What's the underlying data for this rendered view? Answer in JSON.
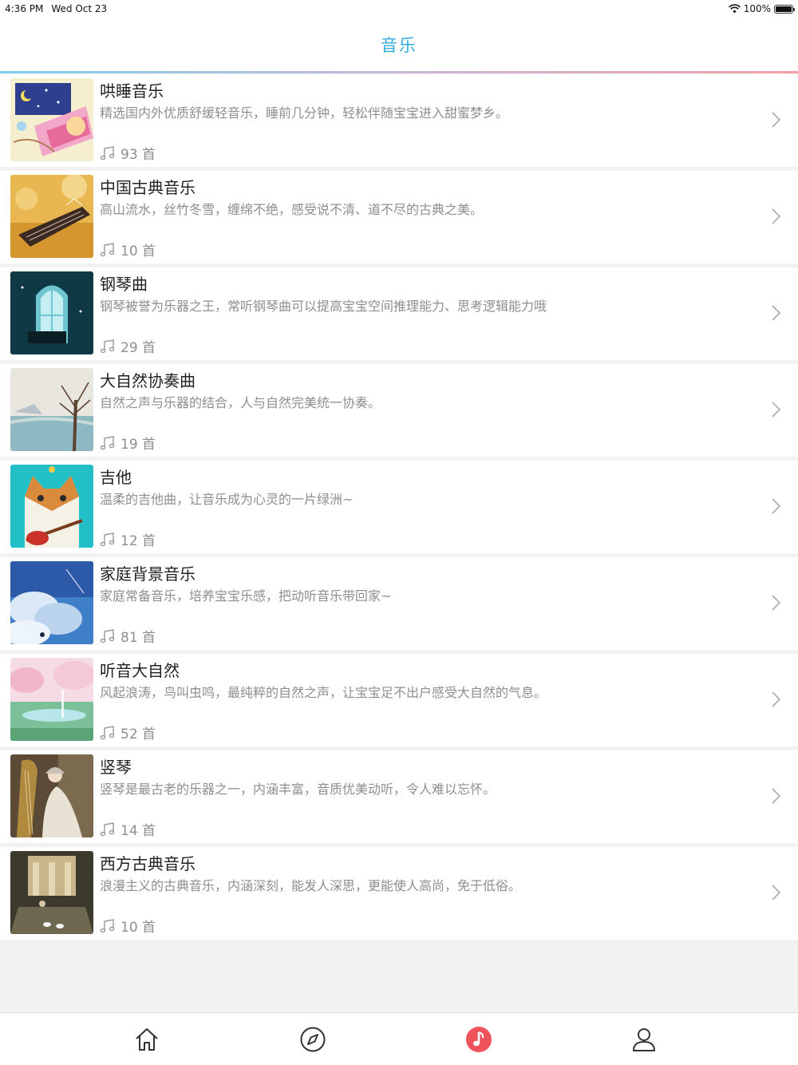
{
  "status": {
    "time": "4:36 PM",
    "date": "Wed Oct 23",
    "battery_text": "100%",
    "battery_level": 1.0
  },
  "header": {
    "title": "音乐"
  },
  "categories": [
    {
      "title": "哄睡音乐",
      "desc": "精选国内外优质舒缓轻音乐，睡前几分钟，轻松伴随宝宝进入甜蜜梦乡。",
      "count": "93 首",
      "thumb_icon": "lullaby-thumbnail"
    },
    {
      "title": "中国古典音乐",
      "desc": "高山流水，丝竹冬雪，缠绵不绝，感受说不清、道不尽的古典之美。",
      "count": "10 首",
      "thumb_icon": "guzheng-thumbnail"
    },
    {
      "title": "钢琴曲",
      "desc": "钢琴被誉为乐器之王，常听钢琴曲可以提高宝宝空间推理能力、思考逻辑能力哦",
      "count": "29 首",
      "thumb_icon": "piano-thumbnail"
    },
    {
      "title": "大自然协奏曲",
      "desc": "自然之声与乐器的结合，人与自然完美统一协奏。",
      "count": "19 首",
      "thumb_icon": "nature-tree-thumbnail"
    },
    {
      "title": "吉他",
      "desc": "温柔的吉他曲，让音乐成为心灵的一片绿洲~",
      "count": "12 首",
      "thumb_icon": "cat-guitar-thumbnail"
    },
    {
      "title": "家庭背景音乐",
      "desc": "家庭常备音乐，培养宝宝乐感，把动听音乐带回家~",
      "count": "81 首",
      "thumb_icon": "sky-thumbnail"
    },
    {
      "title": "听音大自然",
      "desc": "风起浪涛，鸟叫虫鸣，最纯粹的自然之声，让宝宝足不出户感受大自然的气息。",
      "count": "52 首",
      "thumb_icon": "landscape-thumbnail"
    },
    {
      "title": "竖琴",
      "desc": "竖琴是最古老的乐器之一，内涵丰富，音质优美动听，令人难以忘怀。",
      "count": "14 首",
      "thumb_icon": "harp-painting-thumbnail"
    },
    {
      "title": "西方古典音乐",
      "desc": "浪漫主义的古典音乐，内涵深刻，能发人深思，更能使人高尚，免于低俗。",
      "count": "10 首",
      "thumb_icon": "classical-painting-thumbnail"
    }
  ],
  "tabs": [
    {
      "name": "home",
      "icon": "home-icon"
    },
    {
      "name": "discover",
      "icon": "compass-icon"
    },
    {
      "name": "music",
      "icon": "music-note-icon",
      "active": true
    },
    {
      "name": "profile",
      "icon": "person-icon"
    }
  ],
  "colors": {
    "accent": "#34aee0",
    "active_tab": "#f0525c",
    "text_primary": "#222222",
    "text_secondary": "#8e8e8e"
  }
}
